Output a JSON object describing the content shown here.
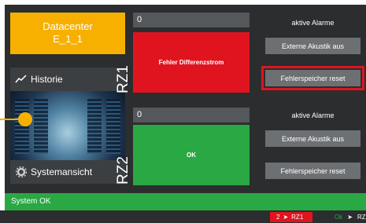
{
  "datacenter": {
    "title": "Datacenter",
    "subtitle": "E_1_1"
  },
  "left_menu": {
    "historie": "Historie",
    "systemansicht": "Systemansicht"
  },
  "rz1": {
    "label": "RZ1",
    "value": "0",
    "status": "Fehler Differenzstrom",
    "alarm_title": "aktive Alarme",
    "btn_acoustic": "Externe Akustik aus",
    "btn_reset": "Fehlerspeicher reset"
  },
  "rz2": {
    "label": "RZ2",
    "value": "0",
    "status": "OK",
    "alarm_title": "aktive Alarme",
    "btn_acoustic": "Externe Akustik aus",
    "btn_reset": "Fehlerspeicher reset"
  },
  "statusbar": {
    "text": "System OK"
  },
  "footer": {
    "red_count": "2",
    "red_label": "RZ1",
    "ok_label": "Ok",
    "ok_rz": "RZ"
  },
  "colors": {
    "accent": "#f7b000",
    "error": "#e0141f",
    "ok": "#2aa844",
    "panel": "#2b2d2f"
  }
}
